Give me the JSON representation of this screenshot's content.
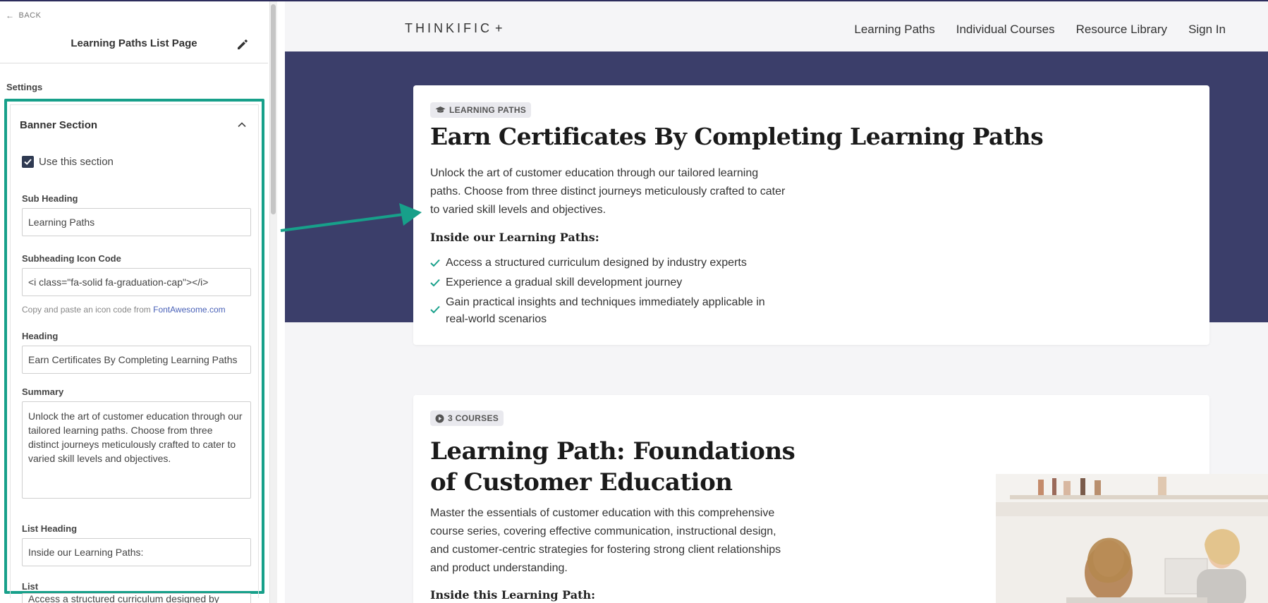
{
  "editor": {
    "back_label": "BACK",
    "page_title": "Learning Paths List Page",
    "settings_label": "Settings",
    "section": {
      "title": "Banner Section",
      "use_section_label": "Use this section",
      "use_section_checked": true,
      "sub_heading_label": "Sub Heading",
      "sub_heading_value": "Learning Paths",
      "icon_code_label": "Subheading Icon Code",
      "icon_code_value": "<i class=\"fa-solid fa-graduation-cap\"></i>",
      "icon_hint": "Copy and paste an icon code from ",
      "icon_hint_link": "FontAwesome.com",
      "heading_label": "Heading",
      "heading_value": "Earn Certificates By Completing Learning Paths",
      "summary_label": "Summary",
      "summary_value": "Unlock the art of customer education through our tailored learning paths. Choose from three distinct journeys meticulously crafted to cater to varied skill levels and objectives.",
      "list_heading_label": "List Heading",
      "list_heading_value": "Inside our Learning Paths:",
      "list_label": "List",
      "list_value": "Access a structured curriculum designed by"
    }
  },
  "preview": {
    "logo": "THINKIFIC",
    "logo_plus": "+",
    "nav": [
      "Learning Paths",
      "Individual Courses",
      "Resource Library",
      "Sign In"
    ],
    "banner_color": "#3b3e6a",
    "accent_color": "#17a08a",
    "card1": {
      "badge": "LEARNING PATHS",
      "badge_icon": "graduation-cap-icon",
      "heading": "Earn Certificates By Completing Learning Paths",
      "summary": "Unlock the art of customer education through our tailored learning paths. Choose from three distinct journeys meticulously crafted to cater to varied skill levels and objectives.",
      "list_heading": "Inside our Learning Paths:",
      "items": [
        "Access a structured curriculum designed by industry experts",
        "Experience a gradual skill development journey",
        "Gain practical insights and techniques immediately applicable in real-world scenarios"
      ]
    },
    "card2": {
      "badge": "3 COURSES",
      "badge_icon": "play-circle-icon",
      "heading": "Learning Path: Foundations of Customer Education",
      "summary": "Master the essentials of customer education with this comprehensive course series, covering effective communication, instructional design, and customer-centric strategies for fostering strong client relationships and product understanding.",
      "list_heading": "Inside this Learning Path:"
    }
  }
}
